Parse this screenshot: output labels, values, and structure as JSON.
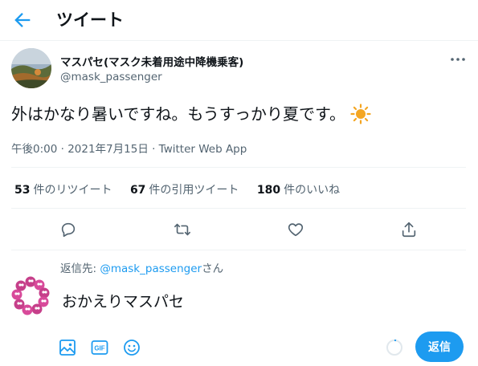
{
  "header": {
    "title": "ツイート",
    "back_icon": "back-arrow-icon"
  },
  "tweet": {
    "display_name": "マスパセ(マスク未着用途中降機乗客)",
    "handle": "@mask_passenger",
    "text": "外はかなり暑いですね。もうすっかり夏です。",
    "emoji_icon": "sun-icon",
    "timestamp": "午後0:00 · 2021年7月15日 · Twitter Web App"
  },
  "stats": {
    "retweets_count": "53",
    "retweets_label": "件のリツイート",
    "quotes_count": "67",
    "quotes_label": "件の引用ツイート",
    "likes_count": "180",
    "likes_label": "件のいいね"
  },
  "actions": [
    "reply-icon",
    "retweet-icon",
    "like-icon",
    "share-icon"
  ],
  "reply": {
    "replying_to_prefix": "返信先: ",
    "replying_to_handle": "@mask_passenger",
    "replying_to_suffix": "さん",
    "input_text": "おかえりマスパセ",
    "button_label": "返信",
    "tools": [
      "image-icon",
      "gif-icon",
      "emoji-icon"
    ]
  },
  "colors": {
    "accent": "#1d9bf0",
    "secondary_text": "#536471",
    "border": "#eff3f4",
    "sun": "#f4a623"
  }
}
